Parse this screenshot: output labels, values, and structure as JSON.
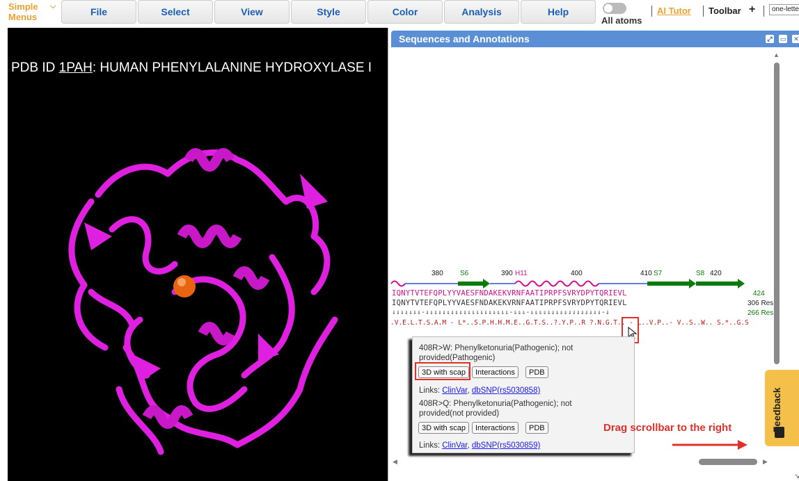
{
  "topbar": {
    "simple_menus": "Simple\nMenus",
    "simple_menus_line1": "Simple",
    "simple_menus_line2": "Menus",
    "menus": [
      "File",
      "Select",
      "View",
      "Style",
      "Color",
      "Analysis",
      "Help"
    ],
    "all_atoms": "All atoms",
    "ai_tutor": "AI Tutor",
    "toolbar": "Toolbar",
    "toolbar_plus": "+",
    "seq_format_value": "one-lette"
  },
  "viewer": {
    "title_prefix": "PDB ID ",
    "pdb_id": "1PAH",
    "title_rest": ": HUMAN PHENYLALANINE HYDROXYLASE I"
  },
  "seqpanel": {
    "title": "Sequences and Annotations",
    "residue_numbers": [
      "380",
      "390",
      "400",
      "410",
      "420"
    ],
    "strand_labels": [
      "S6",
      "S7",
      "S8"
    ],
    "helix_label": "H11",
    "row1": "IQNYTVTEFQPLYYVAESFNDAKEKVRNFAATIPRPFSVRYDPYTQRIEVL",
    "row1_end": "424",
    "row2": "IQNYTVTEFQPLYYVAESFNDAKEKVRNFAATIPRPFSVRYDPYTQRIEVL",
    "row2_end": "306 Res",
    "row3": "⇓⇓⇓⇓⇓⇓⇓-⇓⇓⇓⇓⇓⇓⇓⇓⇓⇓⇓⇓⇓⇓⇓⇓⇓⇓⇓⇓-⇓⇓⇓-⇓⇓⇓⇓⇓⇓⇓⇓⇓⇓⇓⇓⇓⇓⇓⇓⇓-⇓",
    "row3_end": "266 Res",
    "row4": ".V.E.L.T.S.A.M - L*..S.P.H.H.M.E..G.T.S..?.Y.P..R ?.N.G.T.. - L..V.P..- V..S..W.. S.*..G.S..H.N.T..N.P..R.T.T.K - S.."
  },
  "popup": {
    "entry1_line1": "408R>W: Phenylketonuria(Pathogenic); not",
    "entry1_line2": "provided(Pathogenic)",
    "entry2_line1": "408R>Q: Phenylketonuria(Pathogenic); not",
    "entry2_line2": "provided(not provided)",
    "btn_3d": "3D with scap",
    "btn_interactions": "Interactions",
    "btn_pdb": "PDB",
    "links_label": "Links: ",
    "clinvar": "ClinVar",
    "comma": ", ",
    "dbsnp1": "dbSNP(rs5030858)",
    "dbsnp2": "dbSNP(rs5030859)"
  },
  "annotation": {
    "drag_note": "Drag scrollbar to the right"
  },
  "feedback": {
    "label": "Feedback"
  },
  "colors": {
    "accent_orange": "#f0a030",
    "menu_text": "#1a5fb4",
    "panel_header": "#5a8fd6",
    "protein_magenta": "#e020e0",
    "strand_green": "#0a7a0a",
    "highlight_red": "#e0302a"
  }
}
